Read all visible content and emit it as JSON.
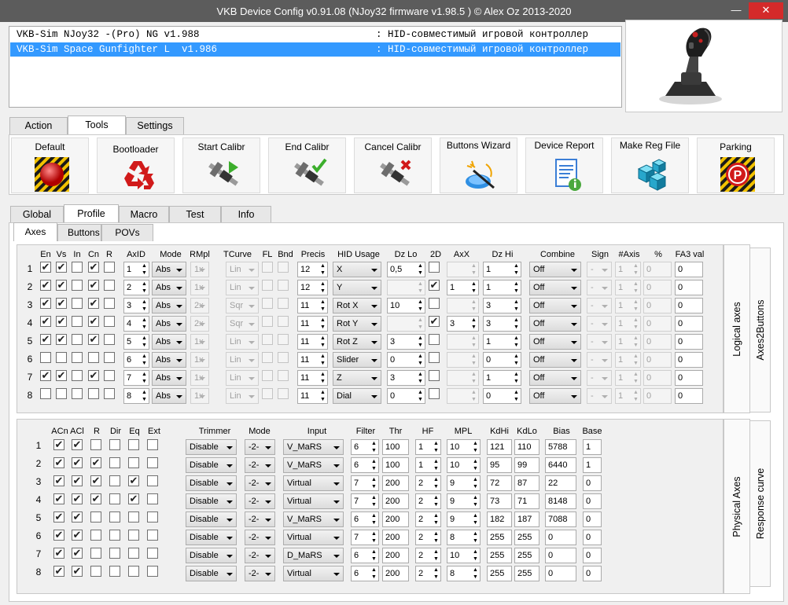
{
  "window": {
    "title": "VKB Device Config v0.91.08 (NJoy32 firmware v1.98.5  ) © Alex Oz 2013-2020",
    "min_glyph": "—",
    "close_glyph": "✕"
  },
  "devices": [
    {
      "name": "VKB-Sim NJoy32 -(Pro) NG v1.988",
      "desc": ": HID-совместимый игровой контроллер",
      "selected": false
    },
    {
      "name": "VKB-Sim Space Gunfighter L  v1.986",
      "desc": ": HID-совместимый игровой контроллер",
      "selected": true
    }
  ],
  "main_tabs": [
    {
      "label": "Action",
      "active": false
    },
    {
      "label": "Tools",
      "active": true
    },
    {
      "label": "Settings",
      "active": false
    }
  ],
  "tools": [
    {
      "label": "Default",
      "icon": "red-ball-icon"
    },
    {
      "label": "Bootloader",
      "icon": "recycle-icon"
    },
    {
      "label": "Start Calibr",
      "icon": "caliper-play-icon"
    },
    {
      "label": "End Calibr",
      "icon": "caliper-check-icon"
    },
    {
      "label": "Cancel Calibr",
      "icon": "caliper-cross-icon"
    },
    {
      "label": "Buttons Wizard",
      "icon": "wizard-wand-icon"
    },
    {
      "label": "Device Report",
      "icon": "document-info-icon"
    },
    {
      "label": "Make Reg File",
      "icon": "registry-cubes-icon"
    },
    {
      "label": "Parking",
      "icon": "parking-icon"
    }
  ],
  "profile_tabs": [
    {
      "label": "Global",
      "active": false
    },
    {
      "label": "Profile",
      "active": true
    },
    {
      "label": "Macro",
      "active": false
    },
    {
      "label": "Test",
      "active": false
    },
    {
      "label": "Info",
      "active": false
    }
  ],
  "sub_tabs": [
    {
      "label": "Axes",
      "active": true
    },
    {
      "label": "Buttons",
      "active": false
    },
    {
      "label": "POVs",
      "active": false
    }
  ],
  "logical": {
    "headers": {
      "en": "En",
      "vs": "Vs",
      "in": "In",
      "cn": "Cn",
      "r": "R",
      "axid": "AxID",
      "mode": "Mode",
      "rmpl": "RMpl",
      "tcurve": "TCurve",
      "fl": "FL",
      "bnd": "Bnd",
      "precis": "Precis",
      "hid": "HID Usage",
      "dzlo": "Dz Lo",
      "d2": "2D",
      "axx": "AxX",
      "dzhi": "Dz Hi",
      "combine": "Combine",
      "sign": "Sign",
      "naxis": "#Axis",
      "pct": "%",
      "fa3": "FA3 val"
    },
    "side_tabs": [
      "Logical axes",
      "Axes2Buttons"
    ],
    "rows": [
      {
        "n": "1",
        "en": true,
        "vs": true,
        "in": false,
        "cn": true,
        "r": false,
        "axid": "1",
        "mode": "Abs",
        "rmpl": "1x",
        "tcurve": "Lin",
        "precis": "12",
        "hid": "X",
        "dzlo": "0,5",
        "d2": false,
        "axx": "",
        "dzhi": "1",
        "combine": "Off",
        "sign": "-",
        "naxis": "1",
        "pct": "0",
        "fa3": "0"
      },
      {
        "n": "2",
        "en": true,
        "vs": true,
        "in": false,
        "cn": true,
        "r": false,
        "axid": "2",
        "mode": "Abs",
        "rmpl": "1x",
        "tcurve": "Lin",
        "precis": "12",
        "hid": "Y",
        "dzlo": "",
        "d2": true,
        "axx": "1",
        "dzhi": "1",
        "combine": "Off",
        "sign": "-",
        "naxis": "1",
        "pct": "0",
        "fa3": "0"
      },
      {
        "n": "3",
        "en": true,
        "vs": true,
        "in": false,
        "cn": true,
        "r": false,
        "axid": "3",
        "mode": "Abs",
        "rmpl": "2x",
        "tcurve": "Sqr",
        "precis": "11",
        "hid": "Rot X",
        "dzlo": "10",
        "d2": false,
        "axx": "",
        "dzhi": "3",
        "combine": "Off",
        "sign": "-",
        "naxis": "1",
        "pct": "0",
        "fa3": "0"
      },
      {
        "n": "4",
        "en": true,
        "vs": true,
        "in": false,
        "cn": true,
        "r": false,
        "axid": "4",
        "mode": "Abs",
        "rmpl": "2x",
        "tcurve": "Sqr",
        "precis": "11",
        "hid": "Rot Y",
        "dzlo": "",
        "d2": true,
        "axx": "3",
        "dzhi": "3",
        "combine": "Off",
        "sign": "-",
        "naxis": "1",
        "pct": "0",
        "fa3": "0"
      },
      {
        "n": "5",
        "en": true,
        "vs": true,
        "in": false,
        "cn": true,
        "r": false,
        "axid": "5",
        "mode": "Abs",
        "rmpl": "1x",
        "tcurve": "Lin",
        "precis": "11",
        "hid": "Rot Z",
        "dzlo": "3",
        "d2": false,
        "axx": "",
        "dzhi": "1",
        "combine": "Off",
        "sign": "-",
        "naxis": "1",
        "pct": "0",
        "fa3": "0"
      },
      {
        "n": "6",
        "en": false,
        "vs": false,
        "in": false,
        "cn": false,
        "r": false,
        "axid": "6",
        "mode": "Abs",
        "rmpl": "1x",
        "tcurve": "Lin",
        "precis": "11",
        "hid": "Slider",
        "dzlo": "0",
        "d2": false,
        "axx": "",
        "dzhi": "0",
        "combine": "Off",
        "sign": "-",
        "naxis": "1",
        "pct": "0",
        "fa3": "0"
      },
      {
        "n": "7",
        "en": true,
        "vs": true,
        "in": false,
        "cn": true,
        "r": false,
        "axid": "7",
        "mode": "Abs",
        "rmpl": "1x",
        "tcurve": "Lin",
        "precis": "11",
        "hid": "Z",
        "dzlo": "3",
        "d2": false,
        "axx": "",
        "dzhi": "1",
        "combine": "Off",
        "sign": "-",
        "naxis": "1",
        "pct": "0",
        "fa3": "0"
      },
      {
        "n": "8",
        "en": false,
        "vs": false,
        "in": false,
        "cn": false,
        "r": false,
        "axid": "8",
        "mode": "Abs",
        "rmpl": "1x",
        "tcurve": "Lin",
        "precis": "11",
        "hid": "Dial",
        "dzlo": "0",
        "d2": false,
        "axx": "",
        "dzhi": "0",
        "combine": "Off",
        "sign": "-",
        "naxis": "1",
        "pct": "0",
        "fa3": "0"
      }
    ]
  },
  "physical": {
    "headers": {
      "acn": "ACn",
      "acl": "ACl",
      "r": "R",
      "dir": "Dir",
      "eq": "Eq",
      "ext": "Ext",
      "trimmer": "Trimmer",
      "mode": "Mode",
      "input": "Input",
      "filter": "Filter",
      "thr": "Thr",
      "hf": "HF",
      "mpl": "MPL",
      "kdhi": "KdHi",
      "kdlo": "KdLo",
      "bias": "Bias",
      "base": "Base"
    },
    "side_tabs": [
      "Physical Axes",
      "Response curve"
    ],
    "rows": [
      {
        "n": "1",
        "acn": true,
        "acl": true,
        "r": false,
        "dir": false,
        "eq": false,
        "ext": false,
        "trimmer": "Disable",
        "mode": "-2-",
        "input": "V_MaRS",
        "filter": "6",
        "thr": "100",
        "hf": "1",
        "mpl": "10",
        "kdhi": "121",
        "kdlo": "110",
        "bias": "5788",
        "base": "1"
      },
      {
        "n": "2",
        "acn": true,
        "acl": true,
        "r": true,
        "dir": false,
        "eq": false,
        "ext": false,
        "trimmer": "Disable",
        "mode": "-2-",
        "input": "V_MaRS",
        "filter": "6",
        "thr": "100",
        "hf": "1",
        "mpl": "10",
        "kdhi": "95",
        "kdlo": "99",
        "bias": "6440",
        "base": "1"
      },
      {
        "n": "3",
        "acn": true,
        "acl": true,
        "r": true,
        "dir": false,
        "eq": true,
        "ext": false,
        "trimmer": "Disable",
        "mode": "-2-",
        "input": "Virtual",
        "filter": "7",
        "thr": "200",
        "hf": "2",
        "mpl": "9",
        "kdhi": "72",
        "kdlo": "87",
        "bias": "22",
        "base": "0"
      },
      {
        "n": "4",
        "acn": true,
        "acl": true,
        "r": true,
        "dir": false,
        "eq": true,
        "ext": false,
        "trimmer": "Disable",
        "mode": "-2-",
        "input": "Virtual",
        "filter": "7",
        "thr": "200",
        "hf": "2",
        "mpl": "9",
        "kdhi": "73",
        "kdlo": "71",
        "bias": "8148",
        "base": "0"
      },
      {
        "n": "5",
        "acn": true,
        "acl": true,
        "r": false,
        "dir": false,
        "eq": false,
        "ext": false,
        "trimmer": "Disable",
        "mode": "-2-",
        "input": "V_MaRS",
        "filter": "6",
        "thr": "200",
        "hf": "2",
        "mpl": "9",
        "kdhi": "182",
        "kdlo": "187",
        "bias": "7088",
        "base": "0"
      },
      {
        "n": "6",
        "acn": true,
        "acl": true,
        "r": false,
        "dir": false,
        "eq": false,
        "ext": false,
        "trimmer": "Disable",
        "mode": "-2-",
        "input": "Virtual",
        "filter": "7",
        "thr": "200",
        "hf": "2",
        "mpl": "8",
        "kdhi": "255",
        "kdlo": "255",
        "bias": "0",
        "base": "0"
      },
      {
        "n": "7",
        "acn": true,
        "acl": true,
        "r": false,
        "dir": false,
        "eq": false,
        "ext": false,
        "trimmer": "Disable",
        "mode": "-2-",
        "input": "D_MaRS",
        "filter": "6",
        "thr": "200",
        "hf": "2",
        "mpl": "10",
        "kdhi": "255",
        "kdlo": "255",
        "bias": "0",
        "base": "0"
      },
      {
        "n": "8",
        "acn": true,
        "acl": true,
        "r": false,
        "dir": false,
        "eq": false,
        "ext": false,
        "trimmer": "Disable",
        "mode": "-2-",
        "input": "Virtual",
        "filter": "6",
        "thr": "200",
        "hf": "2",
        "mpl": "8",
        "kdhi": "255",
        "kdlo": "255",
        "bias": "0",
        "base": "0"
      }
    ]
  },
  "colors": {
    "selection": "#3399ff",
    "titlebar": "#5c5c5c",
    "close_button": "#d42a2a"
  }
}
